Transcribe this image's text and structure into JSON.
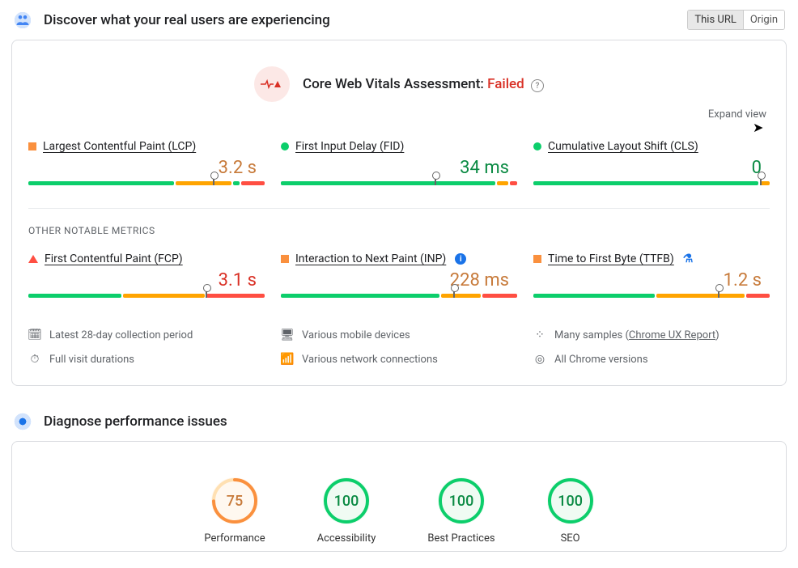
{
  "header1": {
    "title": "Discover what your real users are experiencing",
    "toggle": {
      "this_url": "This URL",
      "origin": "Origin"
    }
  },
  "assessment": {
    "label": "Core Web Vitals Assessment: ",
    "status": "Failed"
  },
  "expand_label": "Expand view",
  "metrics": {
    "lcp": {
      "name": "Largest Contentful Paint (LCP)",
      "value": "3.2 s"
    },
    "fid": {
      "name": "First Input Delay (FID)",
      "value": "34 ms"
    },
    "cls": {
      "name": "Cumulative Layout Shift (CLS)",
      "value": "0"
    },
    "fcp": {
      "name": "First Contentful Paint (FCP)",
      "value": "3.1 s"
    },
    "inp": {
      "name": "Interaction to Next Paint (INP)",
      "value": "228 ms"
    },
    "ttfb": {
      "name": "Time to First Byte (TTFB)",
      "value": "1.2 s"
    }
  },
  "other_label": "OTHER NOTABLE METRICS",
  "info": {
    "i1": "Latest 28-day collection period",
    "i2": "Various mobile devices",
    "i3a": "Many samples (",
    "i3b": "Chrome UX Report",
    "i3c": ")",
    "i4": "Full visit durations",
    "i5": "Various network connections",
    "i6": "All Chrome versions"
  },
  "header2": {
    "title": "Diagnose performance issues"
  },
  "scores": {
    "perf": {
      "value": "75",
      "label": "Performance"
    },
    "a11y": {
      "value": "100",
      "label": "Accessibility"
    },
    "bp": {
      "value": "100",
      "label": "Best Practices"
    },
    "seo": {
      "value": "100",
      "label": "SEO"
    }
  },
  "chart_data": {
    "type": "table",
    "title": "Core Web Vitals Field Data and Lighthouse Scores",
    "field_metrics": [
      {
        "metric": "Largest Contentful Paint (LCP)",
        "value": "3.2 s",
        "status": "needs-improvement",
        "marker_pct": 78
      },
      {
        "metric": "First Input Delay (FID)",
        "value": "34 ms",
        "status": "good",
        "marker_pct": 65
      },
      {
        "metric": "Cumulative Layout Shift (CLS)",
        "value": "0",
        "status": "good",
        "marker_pct": 96
      },
      {
        "metric": "First Contentful Paint (FCP)",
        "value": "3.1 s",
        "status": "poor",
        "marker_pct": 75
      },
      {
        "metric": "Interaction to Next Paint (INP)",
        "value": "228 ms",
        "status": "needs-improvement",
        "marker_pct": 73
      },
      {
        "metric": "Time to First Byte (TTFB)",
        "value": "1.2 s",
        "status": "needs-improvement",
        "marker_pct": 78
      }
    ],
    "lighthouse_scores": [
      {
        "category": "Performance",
        "score": 75
      },
      {
        "category": "Accessibility",
        "score": 100
      },
      {
        "category": "Best Practices",
        "score": 100
      },
      {
        "category": "SEO",
        "score": 100
      }
    ]
  }
}
